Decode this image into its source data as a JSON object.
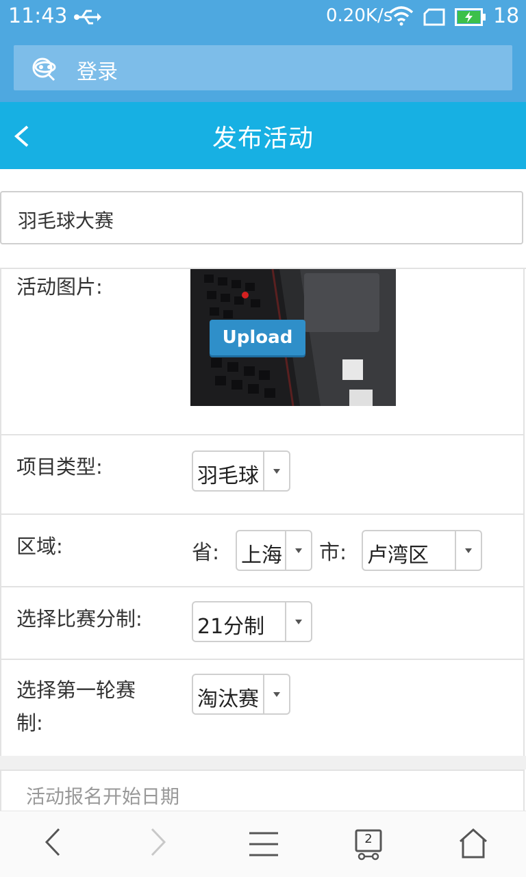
{
  "status": {
    "time": "11:43",
    "net_speed": "0.20K/s",
    "battery": "18"
  },
  "browser": {
    "address_text": "登录"
  },
  "header": {
    "title": "发布活动"
  },
  "form": {
    "name_value": "羽毛球大赛",
    "image_label": "活动图片:",
    "upload_label": "Upload",
    "sport_label": "项目类型:",
    "sport_value": "羽毛球",
    "region_label": "区域:",
    "province_label": "省:",
    "province_value": "上海",
    "city_label": "市:",
    "city_value": "卢湾区",
    "scoring_label": "选择比赛分制:",
    "scoring_value": "21分制",
    "first_round_label": "选择第一轮赛制:",
    "first_round_value": "淘汰赛",
    "start_date_placeholder": "活动报名开始日期"
  },
  "bottom_nav": {
    "tabs_count": "2"
  },
  "colors": {
    "status_bar": "#4ea8e0",
    "title_bar": "#17b0e3",
    "upload_button": "#2f8fc9"
  }
}
